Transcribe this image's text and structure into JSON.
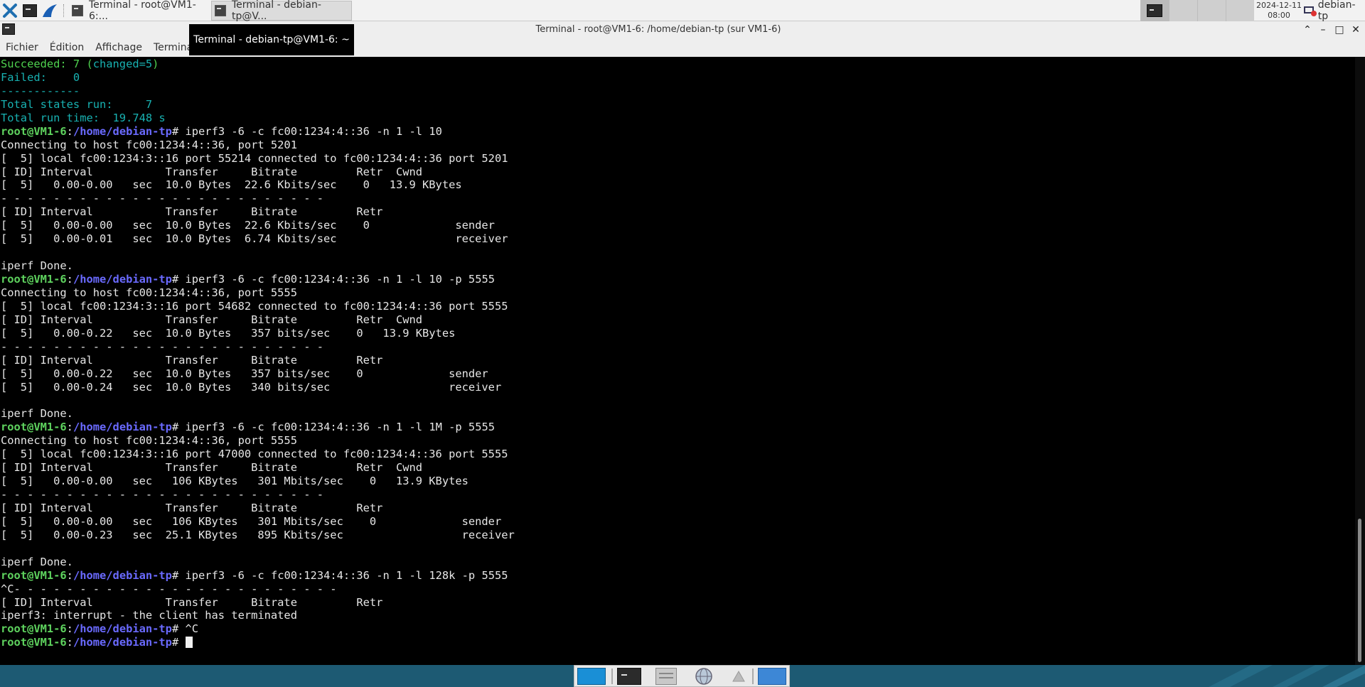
{
  "taskbar": {
    "tasks": [
      {
        "label": "Terminal - root@VM1-6:..."
      },
      {
        "label": "Terminal - debian-tp@V..."
      }
    ],
    "clock": {
      "date": "2024-12-11",
      "time": "08:00"
    },
    "user": "debian-tp"
  },
  "window": {
    "title": "Terminal - root@VM1-6: /home/debian-tp (sur VM1-6)",
    "tooltip": "Terminal - debian-tp@VM1-6: ~"
  },
  "menu": [
    "Fichier",
    "Édition",
    "Affichage",
    "Terminal"
  ],
  "terminal": {
    "prompt_user": "root@VM1-6",
    "prompt_path": "/home/debian-tp",
    "lines": [
      {
        "type": "succeeded",
        "label": "Succeeded: 7 (",
        "changed": "changed=5",
        "close": ")"
      },
      {
        "type": "cyan",
        "text": "Failed:    0"
      },
      {
        "type": "cyan",
        "text": "------------"
      },
      {
        "type": "cyan",
        "text": "Total states run:     7"
      },
      {
        "type": "cyan",
        "text": "Total run time:  19.748 s"
      },
      {
        "type": "prompt",
        "cmd": "iperf3 -6 -c fc00:1234:4::36 -n 1 -l 10"
      },
      {
        "type": "text",
        "text": "Connecting to host fc00:1234:4::36, port 5201"
      },
      {
        "type": "text",
        "text": "[  5] local fc00:1234:3::16 port 55214 connected to fc00:1234:4::36 port 5201"
      },
      {
        "type": "text",
        "text": "[ ID] Interval           Transfer     Bitrate         Retr  Cwnd"
      },
      {
        "type": "text",
        "text": "[  5]   0.00-0.00   sec  10.0 Bytes  22.6 Kbits/sec    0   13.9 KBytes"
      },
      {
        "type": "text",
        "text": "- - - - - - - - - - - - - - - - - - - - - - - - -"
      },
      {
        "type": "text",
        "text": "[ ID] Interval           Transfer     Bitrate         Retr"
      },
      {
        "type": "text",
        "text": "[  5]   0.00-0.00   sec  10.0 Bytes  22.6 Kbits/sec    0             sender"
      },
      {
        "type": "text",
        "text": "[  5]   0.00-0.01   sec  10.0 Bytes  6.74 Kbits/sec                  receiver"
      },
      {
        "type": "text",
        "text": ""
      },
      {
        "type": "text",
        "text": "iperf Done."
      },
      {
        "type": "prompt",
        "cmd": "iperf3 -6 -c fc00:1234:4::36 -n 1 -l 10 -p 5555"
      },
      {
        "type": "text",
        "text": "Connecting to host fc00:1234:4::36, port 5555"
      },
      {
        "type": "text",
        "text": "[  5] local fc00:1234:3::16 port 54682 connected to fc00:1234:4::36 port 5555"
      },
      {
        "type": "text",
        "text": "[ ID] Interval           Transfer     Bitrate         Retr  Cwnd"
      },
      {
        "type": "text",
        "text": "[  5]   0.00-0.22   sec  10.0 Bytes   357 bits/sec    0   13.9 KBytes"
      },
      {
        "type": "text",
        "text": "- - - - - - - - - - - - - - - - - - - - - - - - -"
      },
      {
        "type": "text",
        "text": "[ ID] Interval           Transfer     Bitrate         Retr"
      },
      {
        "type": "text",
        "text": "[  5]   0.00-0.22   sec  10.0 Bytes   357 bits/sec    0             sender"
      },
      {
        "type": "text",
        "text": "[  5]   0.00-0.24   sec  10.0 Bytes   340 bits/sec                  receiver"
      },
      {
        "type": "text",
        "text": ""
      },
      {
        "type": "text",
        "text": "iperf Done."
      },
      {
        "type": "prompt",
        "cmd": "iperf3 -6 -c fc00:1234:4::36 -n 1 -l 1M -p 5555"
      },
      {
        "type": "text",
        "text": "Connecting to host fc00:1234:4::36, port 5555"
      },
      {
        "type": "text",
        "text": "[  5] local fc00:1234:3::16 port 47000 connected to fc00:1234:4::36 port 5555"
      },
      {
        "type": "text",
        "text": "[ ID] Interval           Transfer     Bitrate         Retr  Cwnd"
      },
      {
        "type": "text",
        "text": "[  5]   0.00-0.00   sec   106 KBytes   301 Mbits/sec    0   13.9 KBytes"
      },
      {
        "type": "text",
        "text": "- - - - - - - - - - - - - - - - - - - - - - - - -"
      },
      {
        "type": "text",
        "text": "[ ID] Interval           Transfer     Bitrate         Retr"
      },
      {
        "type": "text",
        "text": "[  5]   0.00-0.00   sec   106 KBytes   301 Mbits/sec    0             sender"
      },
      {
        "type": "text",
        "text": "[  5]   0.00-0.23   sec  25.1 KBytes   895 Kbits/sec                  receiver"
      },
      {
        "type": "text",
        "text": ""
      },
      {
        "type": "text",
        "text": "iperf Done."
      },
      {
        "type": "prompt",
        "cmd": "iperf3 -6 -c fc00:1234:4::36 -n 1 -l 128k -p 5555"
      },
      {
        "type": "text",
        "text": "^C- - - - - - - - - - - - - - - - - - - - - - - - -"
      },
      {
        "type": "text",
        "text": "[ ID] Interval           Transfer     Bitrate         Retr"
      },
      {
        "type": "text",
        "text": "iperf3: interrupt - the client has terminated"
      },
      {
        "type": "prompt",
        "cmd": "^C"
      },
      {
        "type": "prompt",
        "cmd": "",
        "cursor": true
      }
    ]
  },
  "dock": {
    "items": [
      "desktop-icon",
      "terminal-icon",
      "file-manager-icon",
      "web-browser-icon",
      "app-finder-icon",
      "folder-icon"
    ]
  }
}
